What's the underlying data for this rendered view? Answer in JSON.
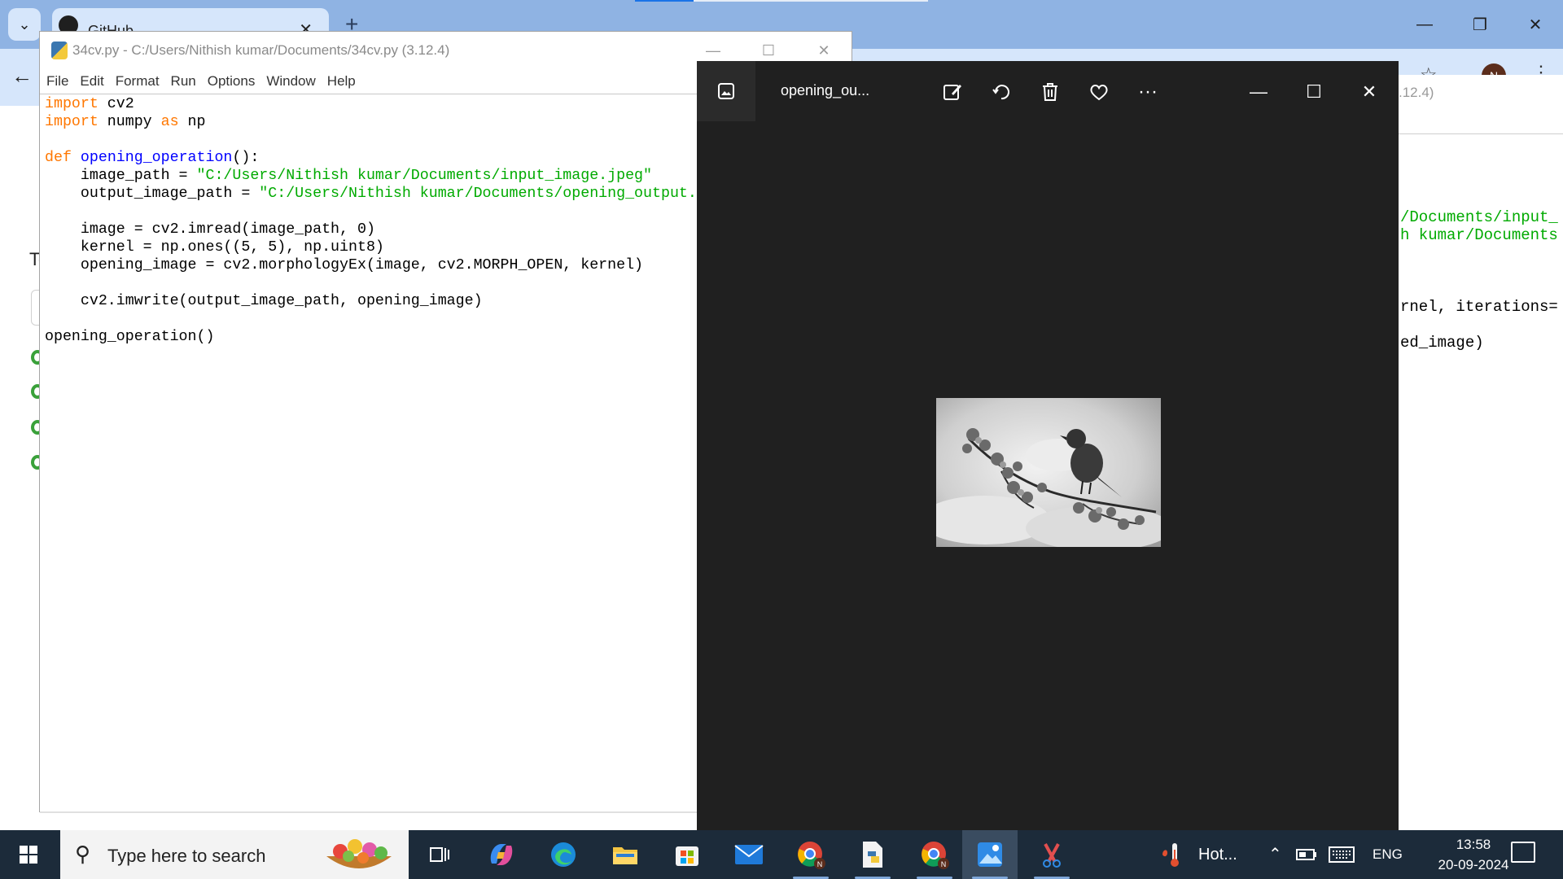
{
  "browser": {
    "tab_title": "GitHub",
    "new_tab": "+",
    "profile_initial": "N",
    "page_partial_text": "To"
  },
  "idle": {
    "title": "34cv.py - C:/Users/Nithish kumar/Documents/34cv.py (3.12.4)",
    "menu": [
      "File",
      "Edit",
      "Format",
      "Run",
      "Options",
      "Window",
      "Help"
    ]
  },
  "right_window": {
    "title_partial": ".12.4)",
    "code_lines": [
      "/Documents/input_",
      "h kumar/Documents",
      "rnel, iterations=",
      "ed_image)"
    ]
  },
  "photos": {
    "filename": "opening_ou...",
    "more_label": "···"
  },
  "taskbar": {
    "search_placeholder": "Type here to search",
    "weather_text": "Hot...",
    "language": "ENG",
    "time": "13:58",
    "date": "20-09-2024"
  },
  "colors": {
    "taskbar_bg": "#1c2b3a",
    "photos_bg": "#202020",
    "keyword": "#ff7700",
    "string": "#00aa00",
    "function": "#0000ff"
  }
}
